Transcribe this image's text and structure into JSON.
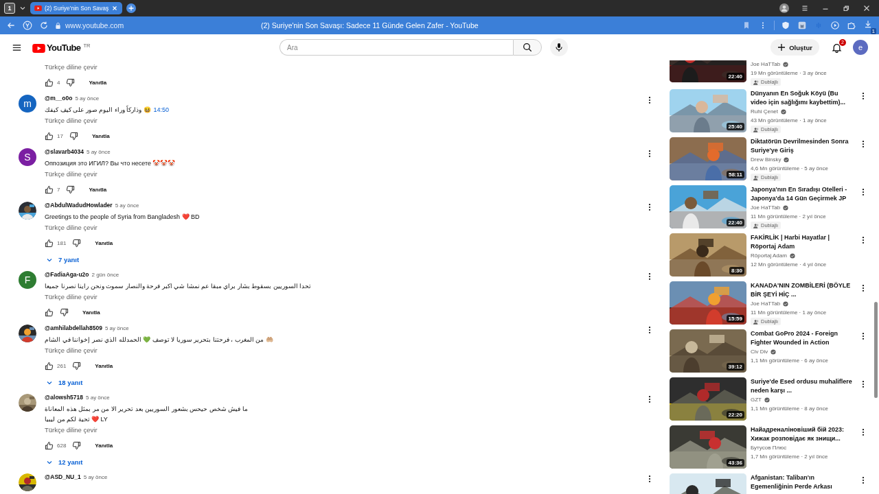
{
  "browser": {
    "tab_count": "1",
    "tab_title": "(2) Suriye'nin Son Savaş",
    "url": "www.youtube.com",
    "page_title": "(2) Suriye'nin Son Savaşı: Sadece 11 Günde Gelen Zafer - YouTube",
    "extension_badge": "1"
  },
  "header": {
    "logo_text": "YouTube",
    "region": "TR",
    "search_placeholder": "Ara",
    "create_label": "Oluştur",
    "notification_count": "2",
    "avatar_letter": "e"
  },
  "comments": [
    {
      "translate": "Türkçe diline çevir",
      "likes": "4",
      "reply": "Yanıtla"
    },
    {
      "author": "@m__o0o",
      "time": "5 ay önce",
      "avatar": {
        "kind": "letter",
        "letter": "m",
        "color": "#1565c0"
      },
      "lines": [
        "وذاركاً وراء اليوم صور على كيف كيفك 😆"
      ],
      "timestamp": "14:50",
      "translate": "Türkçe diline çevir",
      "likes": "17",
      "reply": "Yanıtla"
    },
    {
      "author": "@slavarb4034",
      "time": "5 ay önce",
      "avatar": {
        "kind": "letter",
        "letter": "S",
        "color": "#7b1fa2"
      },
      "lines": [
        "Оппозиция это ИГИЛ? Вы что несете 🤡🤡🤡"
      ],
      "translate": "Türkçe diline çevir",
      "likes": "7",
      "reply": "Yanıtla"
    },
    {
      "author": "@AbdulWadudHowlader",
      "time": "5 ay önce",
      "avatar": {
        "kind": "picture"
      },
      "lines": [
        "Greetings to the people of Syria from Bangladesh ❤️ BD"
      ],
      "translate": "Türkçe diline çevir",
      "likes": "181",
      "reply": "Yanıtla",
      "replies": "7 yanıt"
    },
    {
      "author": "@FadiaAga-u2o",
      "time": "2 gün önce",
      "avatar": {
        "kind": "letter",
        "letter": "F",
        "color": "#2e7d32"
      },
      "lines": [
        "تحدا السوريين بسقوط بشار براي مبقا عم نمشا شي اكبر فرحة والنصار سموت ونحن راينا نصرنا جميعا"
      ],
      "translate": "Türkçe diline çevir",
      "reply": "Yanıtla"
    },
    {
      "author": "@amhilabdellah8509",
      "time": "5 ay önce",
      "avatar": {
        "kind": "picture"
      },
      "lines": [
        "من المغرب ، فرحتنا بتحرير سوريا لا توصف 💚 الحمدلله الذي نصر إخواننا في الشام 🤲🏼"
      ],
      "translate": "Türkçe diline çevir",
      "likes": "261",
      "reply": "Yanıtla",
      "replies": "18 yanıt"
    },
    {
      "author": "@alowsh5718",
      "time": "5 ay önce",
      "avatar": {
        "kind": "picture"
      },
      "lines": [
        "ما فيش شخص حيحس بشعور السوريين بعد تحرير الا من مر بمثل هذه المعاناة",
        "تحية لكم من ليبيا ❤️ LY"
      ],
      "translate": "Türkçe diline çevir",
      "likes": "628",
      "reply": "Yanıtla",
      "replies": "12 yanıt"
    },
    {
      "author": "@ASD_NU_1",
      "time": "5 ay önce",
      "avatar": {
        "kind": "picture"
      }
    }
  ],
  "videos": [
    {
      "channel": "Joe HaTTab",
      "verified": true,
      "stats": "19 Mn görüntüleme · 3 ay önce",
      "duration": "22:40",
      "dubbed": "Dublajlı"
    },
    {
      "title": "Dünyanın En Soğuk Köyü (Bu video için sağlığımı kaybettim)...",
      "channel": "Ruhi Çenet",
      "verified": true,
      "stats": "43 Mn görüntüleme · 1 ay önce",
      "duration": "25:40",
      "dubbed": "Dublajlı"
    },
    {
      "title": "Diktatörün Devrilmesinden Sonra Suriye'ye Giriş",
      "channel": "Drew Binsky",
      "verified": true,
      "stats": "4,6 Mn görüntüleme · 5 ay önce",
      "duration": "58:11",
      "dubbed": "Dublajlı"
    },
    {
      "title": "Japonya'nın En Sıradışı Otelleri - Japonya'da 14 Gün Geçirmek JP",
      "channel": "Joe HaTTab",
      "verified": true,
      "stats": "11 Mn görüntüleme · 2 yıl önce",
      "duration": "22:40",
      "dubbed": "Dublajlı"
    },
    {
      "title": "FAKİRLİK | Harbi Hayatlar | Röportaj Adam",
      "channel": "Röportaj Adam",
      "verified": true,
      "stats": "12 Mn görüntüleme · 4 yıl önce",
      "duration": "8:30"
    },
    {
      "title": "KANADA'NIN ZOMBİLERİ (BÖYLE BİR ŞEYİ HİÇ ...",
      "channel": "Joe HaTTab",
      "verified": true,
      "stats": "11 Mn görüntüleme · 1 ay önce",
      "duration": "15:59",
      "dubbed": "Dublajlı"
    },
    {
      "title": "Combat GoPro 2024 - Foreign Fighter Wounded in Action",
      "channel": "Civ Div",
      "verified": true,
      "stats": "1,1 Mn görüntüleme · 6 ay önce",
      "duration": "39:12"
    },
    {
      "title": "Suriye'de Esed ordusu muhaliflere neden karşı ...",
      "channel": "GZT",
      "verified": true,
      "stats": "1,1 Mn görüntüleme · 8 ay önce",
      "duration": "22:20"
    },
    {
      "title": "Найадреналіновіший бій 2023: Хижак розповідає як знищи...",
      "channel": "Бутусов Плюс",
      "verified": false,
      "stats": "1,7 Mn görüntüleme · 2 yıl önce",
      "duration": "43:36"
    },
    {
      "title": "Afganistan: Taliban'ın Egemenliğinin Perde Arkası"
    }
  ]
}
